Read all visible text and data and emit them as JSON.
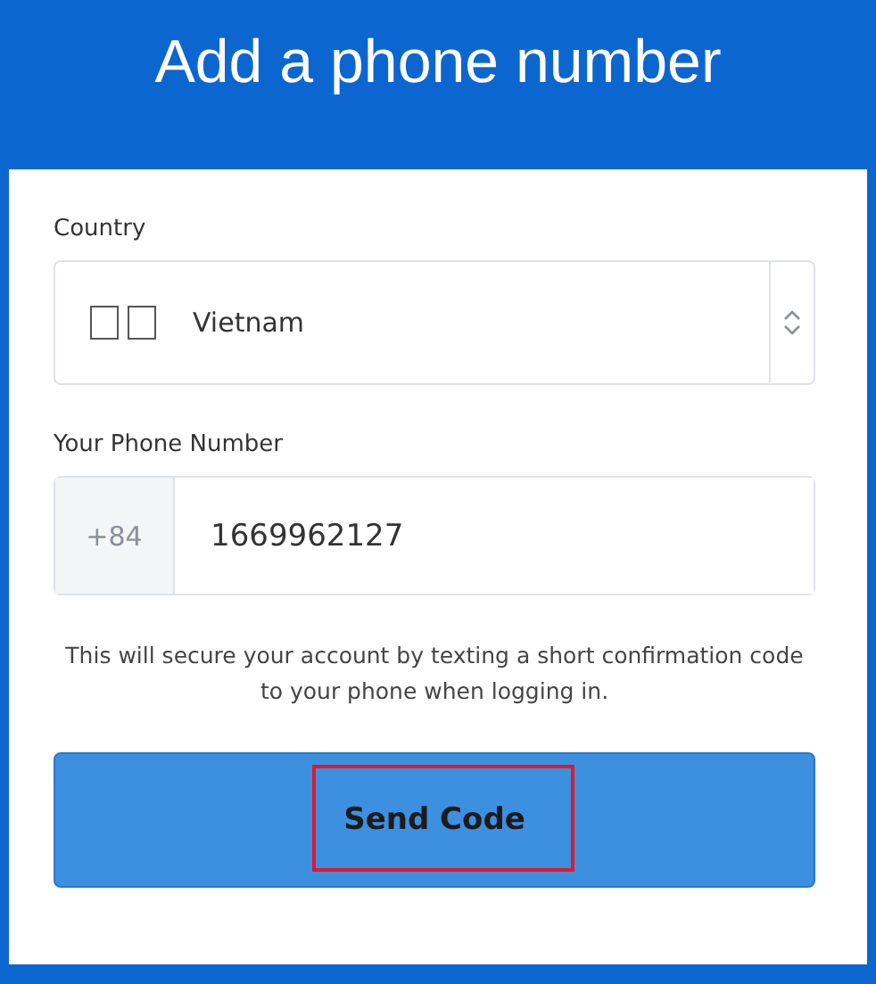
{
  "title": "Add a phone number",
  "country": {
    "label": "Country",
    "value": "Vietnam"
  },
  "phone": {
    "label": "Your Phone Number",
    "prefix": "+84",
    "value": "1669962127"
  },
  "note": "This will secure your account by texting a short confirmation code to your phone when logging in.",
  "button": {
    "label": "Send Code",
    "highlighted": true
  }
}
